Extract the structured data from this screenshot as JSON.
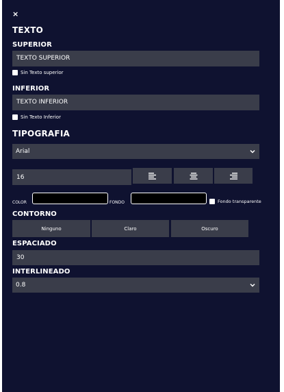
{
  "close_label": "×",
  "title": "TEXTO",
  "superior": {
    "label": "SUPERIOR",
    "value": "TEXTO SUPERIOR",
    "checkbox_label": "Sin Texto superior"
  },
  "inferior": {
    "label": "INFERIOR",
    "value": "TEXTO INFERIOR",
    "checkbox_label": "Sin Texto Inferior"
  },
  "tipografia": {
    "label": "TIPOGRAFIA",
    "font_value": "Arial",
    "size_value": "16"
  },
  "align_icons": [
    "align-left-icon",
    "align-center-icon",
    "align-right-icon"
  ],
  "colors": {
    "color_label": "COLOR",
    "fondo_label": "FONDO",
    "transparent_label": "Fondo transparente",
    "text_color": "#000000",
    "background_color": "#000000"
  },
  "contorno": {
    "label": "CONTORNO",
    "options": [
      "Ninguno",
      "Claro",
      "Oscuro"
    ]
  },
  "espaciado": {
    "label": "ESPACIADO",
    "value": "30"
  },
  "interlineado": {
    "label": "INTERLINEADO",
    "value": "0.8"
  },
  "theme": {
    "panel_bg": "#0f1230",
    "control_bg": "#3a3d4a"
  }
}
